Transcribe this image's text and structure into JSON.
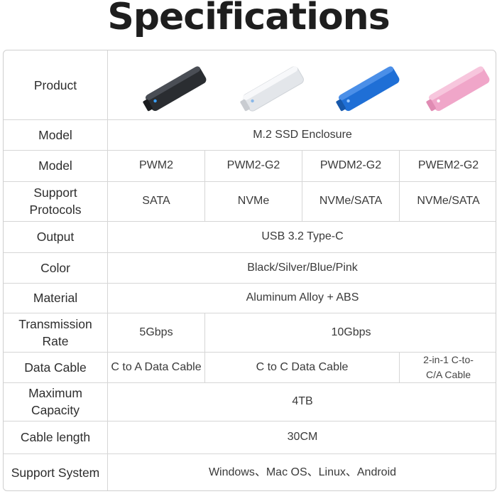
{
  "title": "Specifications",
  "rows": {
    "product": {
      "label": "Product"
    },
    "model_family": {
      "label": "Model",
      "value": "M.2 SSD Enclosure"
    },
    "model": {
      "label": "Model",
      "values": [
        "PWM2",
        "PWM2-G2",
        "PWDM2-G2",
        "PWEM2-G2"
      ]
    },
    "protocols": {
      "label_line1": "Support",
      "label_line2": "Protocols",
      "values": [
        "SATA",
        "NVMe",
        "NVMe/SATA",
        "NVMe/SATA"
      ]
    },
    "output": {
      "label": "Output",
      "value": "USB 3.2 Type-C"
    },
    "color": {
      "label": "Color",
      "value": "Black/Silver/Blue/Pink"
    },
    "material": {
      "label": "Material",
      "value": "Aluminum Alloy + ABS"
    },
    "rate": {
      "label_line1": "Transmission",
      "label_line2": "Rate",
      "values": [
        "5Gbps",
        "10Gbps"
      ]
    },
    "cable": {
      "label": "Data Cable",
      "values": [
        "C to A Data Cable",
        "C to C Data Cable"
      ],
      "value_last_line1": "2-in-1 C-to-",
      "value_last_line2": "C/A Cable"
    },
    "capacity": {
      "label_line1": "Maximum",
      "label_line2": "Capacity",
      "value": "4TB"
    },
    "cable_length": {
      "label": "Cable length",
      "value": "30CM"
    },
    "system": {
      "label": "Support System",
      "value": "Windows、Mac OS、Linux、Android"
    }
  },
  "products": [
    {
      "color_name": "black",
      "body": "#2a2d31",
      "top": "#4a4e55",
      "led": "#3aa0ff"
    },
    {
      "color_name": "silver",
      "body": "#e9ebee",
      "top": "#f7f8fa",
      "led": "#8ab8e8"
    },
    {
      "color_name": "blue",
      "body": "#1f6fd6",
      "top": "#4b8fe8",
      "led": "#9cc8ff"
    },
    {
      "color_name": "pink",
      "body": "#f0a6c9",
      "top": "#f7c6dd",
      "led": "#ffffff"
    }
  ]
}
